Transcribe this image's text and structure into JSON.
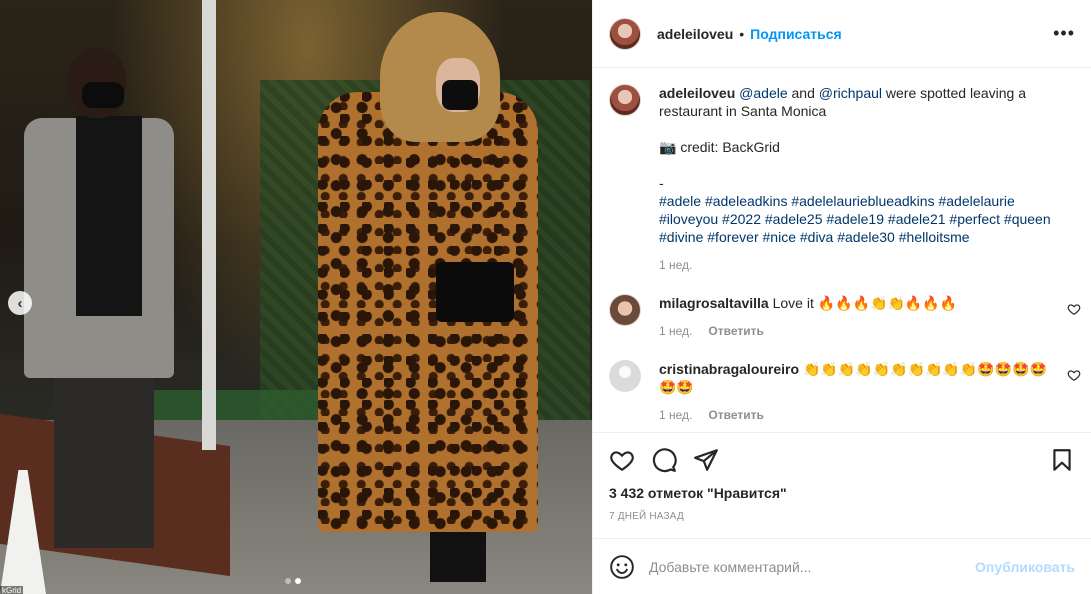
{
  "post": {
    "author": "adeleiloveu",
    "follow_label": "Подписаться",
    "separator": "•",
    "more_label": "•••",
    "caption": {
      "author": "adeleiloveu",
      "mention_1": "@adele",
      "text_and": " and ",
      "mention_2": "@richpaul",
      "text_rest": " were spotted leaving a restaurant in Santa Monica",
      "credit": "📷 credit: BackGrid",
      "dash": "-",
      "hashtags": [
        "#adele",
        "#adeleadkins",
        "#adelelaurieblueadkins",
        "#adelelaurie",
        "#iloveyou",
        "#2022",
        "#adele25",
        "#adele19",
        "#adele21",
        "#perfect",
        "#queen",
        "#divine",
        "#forever",
        "#nice",
        "#diva",
        "#adele30",
        "#helloitsme"
      ],
      "time": "1 нед."
    },
    "comments": [
      {
        "user": "milagrosaltavilla",
        "text": "Love it 🔥🔥🔥👏👏🔥🔥🔥",
        "time": "1 нед.",
        "reply_label": "Ответить"
      },
      {
        "user": "cristinabragaloureiro",
        "text": "👏👏👏👏👏👏👏👏👏👏🤩🤩🤩🤩🤩🤩",
        "time": "1 нед.",
        "reply_label": "Ответить"
      }
    ],
    "likes_text": "3 432 отметок \"Нравится\"",
    "date_text": "7 ДНЕЙ НАЗАД",
    "comment_placeholder": "Добавьте комментарий...",
    "publish_label": "Опубликовать"
  },
  "media": {
    "prev_label": "‹",
    "slide_count": 2,
    "active_slide": 2,
    "watermark": "kGrid"
  },
  "icons": [
    "chevron-left-icon",
    "more-icon",
    "heart-icon",
    "comment-icon",
    "share-icon",
    "bookmark-icon",
    "emoji-icon"
  ],
  "colors": {
    "link": "#00376b",
    "follow": "#0095f6",
    "publish_disabled": "#b3dbff",
    "muted": "#8e8e8e"
  }
}
